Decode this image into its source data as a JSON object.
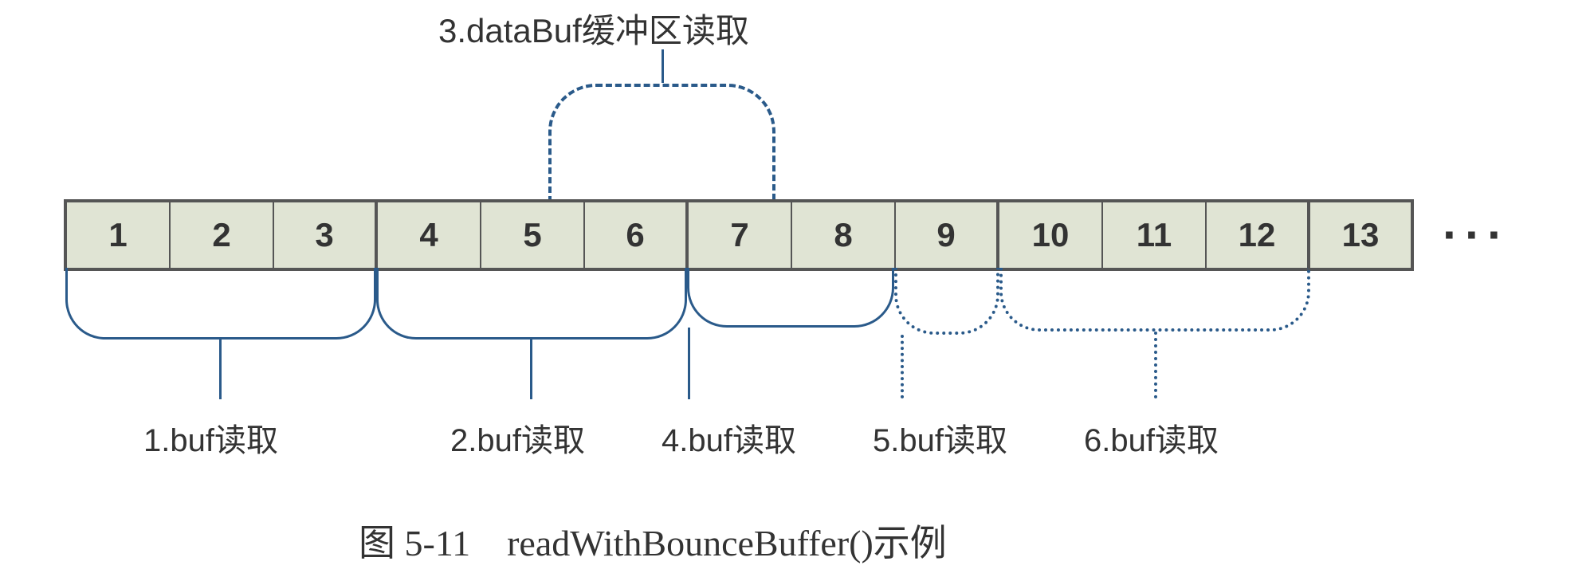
{
  "top_label": "3.dataBuf缓冲区读取",
  "cells": [
    "1",
    "2",
    "3",
    "4",
    "5",
    "6",
    "7",
    "8",
    "9",
    "10",
    "11",
    "12",
    "13"
  ],
  "ellipsis": "···",
  "bottom_labels": {
    "b1": "1.buf读取",
    "b2": "2.buf读取",
    "b4": "4.buf读取",
    "b5": "5.buf读取",
    "b6": "6.buf读取"
  },
  "caption": "图 5-11　readWithBounceBuffer()示例"
}
